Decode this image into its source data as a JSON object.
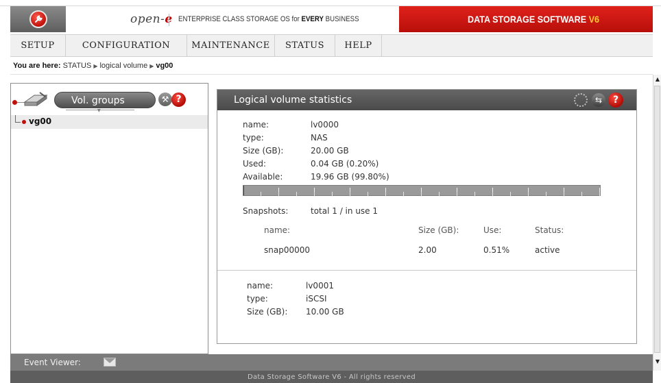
{
  "header": {
    "brand_prefix": "open-",
    "brand_suffix": "e",
    "tagline_prefix": "ENTERPRISE CLASS STORAGE OS for ",
    "tagline_bold": "EVERY",
    "tagline_suffix": " BUSINESS",
    "product_title": "DATA STORAGE SOFTWARE ",
    "product_version": "V6",
    "brand_color": "#c0100a"
  },
  "menu": {
    "items": [
      {
        "label": "SETUP"
      },
      {
        "label": "CONFIGURATION"
      },
      {
        "label": "MAINTENANCE"
      },
      {
        "label": "STATUS"
      },
      {
        "label": "HELP"
      }
    ]
  },
  "breadcrumb": {
    "label": "You are here:",
    "items": [
      "STATUS",
      "logical volume",
      "vg00"
    ]
  },
  "left_pane": {
    "button_label": "Vol. groups",
    "tree": [
      {
        "label": "vg00"
      }
    ],
    "icons": [
      "disk-icon",
      "tools-icon",
      "help-icon"
    ]
  },
  "stats": {
    "title": "Logical volume statistics",
    "icons": [
      "settings-icon",
      "refresh-icon",
      "help-icon"
    ],
    "volumes": [
      {
        "name_label": "name:",
        "name": "lv0000",
        "type_label": "type:",
        "type": "NAS",
        "size_label": "Size (GB):",
        "size": "20.00 GB",
        "used_label": "Used:",
        "used": "0.04 GB (0.20%)",
        "available_label": "Available:",
        "available": "19.96 GB (99.80%)",
        "usage_fraction": 0.002,
        "snapshots_label": "Snapshots:",
        "snapshots_summary": "total 1 / in use 1",
        "snapshot_columns": [
          "name:",
          "Size (GB):",
          "Use:",
          "Status:"
        ],
        "snapshots": [
          {
            "name": "snap00000",
            "size": "2.00",
            "use": "0.51%",
            "status": "active"
          }
        ]
      },
      {
        "name_label": "name:",
        "name": "lv0001",
        "type_label": "type:",
        "type": "iSCSI",
        "size_label": "Size (GB):",
        "size": "10.00 GB"
      }
    ]
  },
  "bottom": {
    "event_viewer_label": "Event Viewer:",
    "footer_text": "Data Storage Software V6 - All rights reserved"
  }
}
